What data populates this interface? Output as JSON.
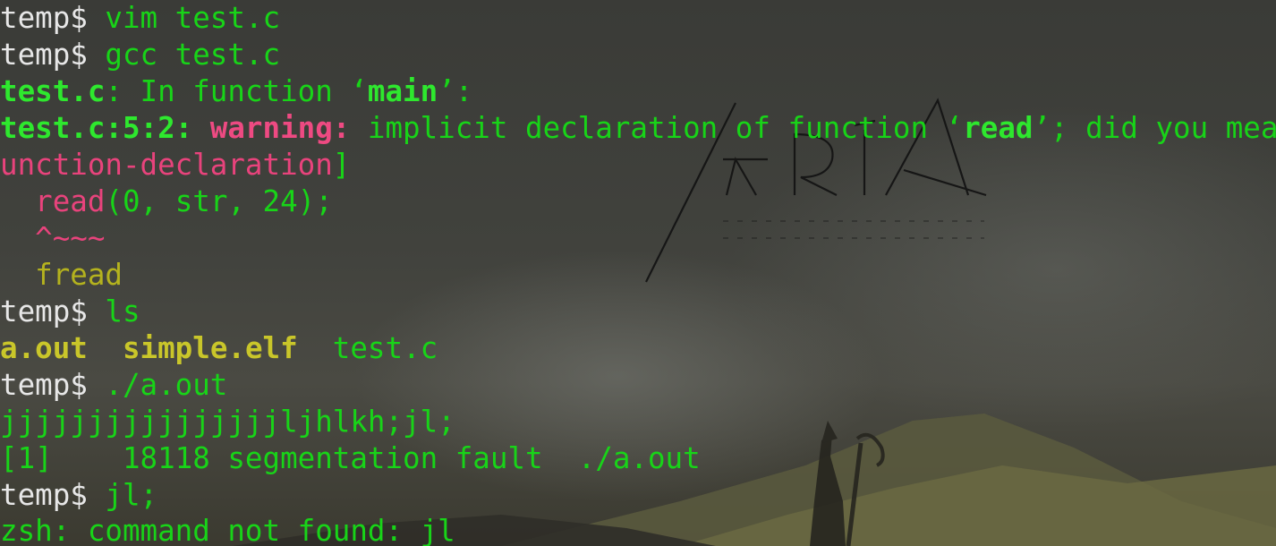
{
  "wallpaper": {
    "logo_text": "ARIA",
    "scene": "misty mountains with a wizard silhouette holding a staff"
  },
  "terminal": {
    "prompt": "temp$",
    "lines": [
      {
        "prompt": "temp$",
        "command": " vim test.c"
      },
      {
        "prompt": "temp$",
        "command": " gcc test.c"
      },
      {
        "file": "test.c",
        "text1": ": In function ",
        "q1": "‘",
        "fn": "main",
        "q2": "’:"
      },
      {
        "loc": "test.c:5:2:",
        "kind": " warning:",
        "msg": " implicit declaration of function ",
        "q1": "‘",
        "fn": "read",
        "q2": "’; did you mea"
      },
      {
        "flag": "unction-declaration",
        "close": "]"
      },
      {
        "indent": "  ",
        "call": "read",
        "args": "(0, str, 24);"
      },
      {
        "indent": "  ",
        "caret": "^~~~"
      },
      {
        "indent": "  ",
        "suggest": "fread"
      },
      {
        "prompt": "temp$",
        "command": " ls"
      },
      {
        "f1": "a.out",
        "sep1": "  ",
        "f2": "simple.elf",
        "sep2": "  ",
        "f3": "test.c"
      },
      {
        "prompt": "temp$",
        "command": " ./a.out"
      },
      {
        "text": "jjjjjjjjjjjjjjjjljhlkh;jl;"
      },
      {
        "text": "[1]    18118 segmentation fault  ./a.out"
      },
      {
        "prompt": "temp$",
        "command": " jl;"
      },
      {
        "text": "zsh: command not found: jl"
      }
    ]
  },
  "colors": {
    "prompt": "#e7e7e7",
    "command": "#18d418",
    "error_pink": "#e8437c",
    "executable_olive": "#b4b21e"
  }
}
